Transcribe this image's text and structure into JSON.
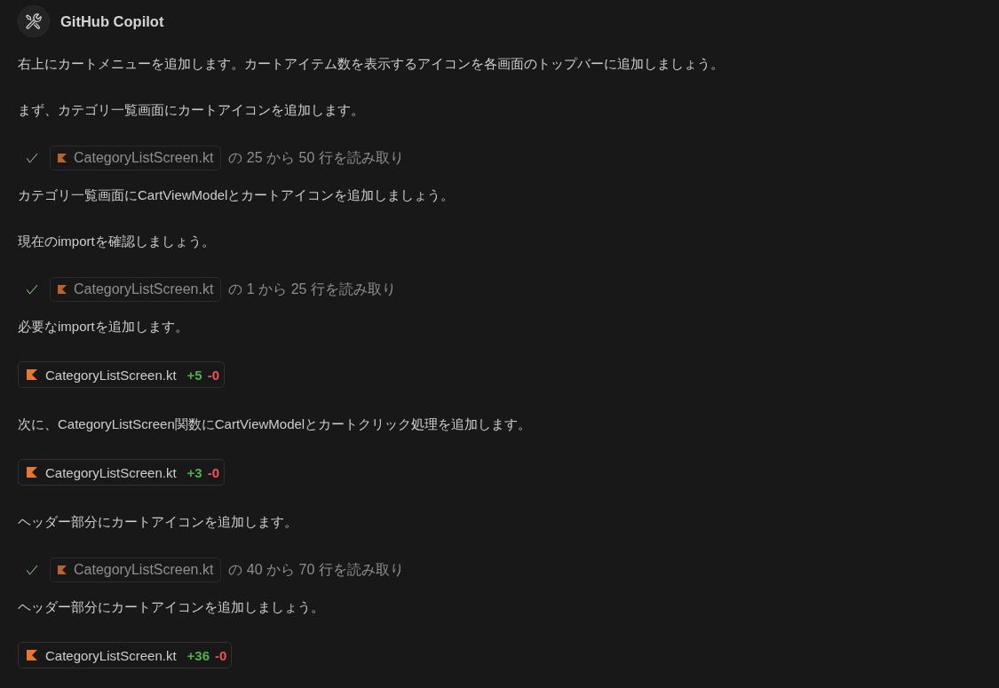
{
  "header": {
    "title": "GitHub Copilot"
  },
  "blocks": [
    {
      "kind": "text",
      "text": "右上にカートメニューを追加します。カートアイテム数を表示するアイコンを各画面のトップバーに追加しましょう。"
    },
    {
      "kind": "text",
      "text": "まず、カテゴリ一覧画面にカートアイコンを追加します。"
    },
    {
      "kind": "read",
      "done": true,
      "file": "CategoryListScreen.kt",
      "detail": "の 25 から 50 行を読み取り"
    },
    {
      "kind": "text",
      "text": "カテゴリ一覧画面にCartViewModelとカートアイコンを追加しましょう。"
    },
    {
      "kind": "text",
      "text": "現在のimportを確認しましょう。"
    },
    {
      "kind": "read",
      "done": true,
      "file": "CategoryListScreen.kt",
      "detail": "の 1 から 25 行を読み取り"
    },
    {
      "kind": "text",
      "text": "必要なimportを追加します。"
    },
    {
      "kind": "edit",
      "file": "CategoryListScreen.kt",
      "added": "+5",
      "removed": "-0"
    },
    {
      "kind": "text",
      "text": "次に、CategoryListScreen関数にCartViewModelとカートクリック処理を追加します。"
    },
    {
      "kind": "edit",
      "file": "CategoryListScreen.kt",
      "added": "+3",
      "removed": "-0"
    },
    {
      "kind": "text",
      "text": "ヘッダー部分にカートアイコンを追加します。"
    },
    {
      "kind": "read",
      "done": true,
      "file": "CategoryListScreen.kt",
      "detail": "の 40 から 70 行を読み取り"
    },
    {
      "kind": "text",
      "text": "ヘッダー部分にカートアイコンを追加しましょう。"
    },
    {
      "kind": "edit",
      "file": "CategoryListScreen.kt",
      "added": "+36",
      "removed": "-0"
    }
  ]
}
